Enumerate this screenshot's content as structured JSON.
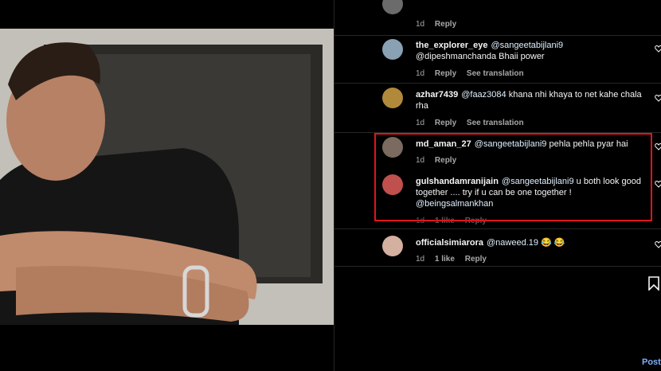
{
  "comments": [
    {
      "username": "",
      "text": "",
      "time": "1d",
      "likes": "",
      "reply": "Reply",
      "translate": ""
    },
    {
      "username": "the_explorer_eye",
      "mention": "@sangeetabijlani9",
      "text": "@dipeshmanchanda Bhaii power",
      "time": "1d",
      "likes": "",
      "reply": "Reply",
      "translate": "See translation"
    },
    {
      "username": "azhar7439",
      "mention": "@faaz3084",
      "text": "khana nhi khaya to net kahe chala rha",
      "time": "1d",
      "likes": "",
      "reply": "Reply",
      "translate": "See translation"
    },
    {
      "username": "md_aman_27",
      "mention": "@sangeetabijlani9",
      "text": "pehla pehla pyar hai",
      "time": "1d",
      "likes": "",
      "reply": "Reply",
      "translate": ""
    },
    {
      "username": "gulshandamranijain",
      "mention": "@sangeetabijlani9",
      "text": "u both look good together .... try if u can be one together !",
      "mention2": "@beingsalmankhan",
      "time": "1d",
      "likes": "1 like",
      "reply": "Reply",
      "translate": ""
    },
    {
      "username": "officialsimiarora",
      "mention": "@naweed.19",
      "text": "😂 😂",
      "time": "1d",
      "likes": "1 like",
      "reply": "Reply",
      "translate": ""
    }
  ],
  "post_label": "Post",
  "colors": {
    "highlight": "#e0141c",
    "background": "#000000",
    "muted": "#a8a8a8"
  }
}
